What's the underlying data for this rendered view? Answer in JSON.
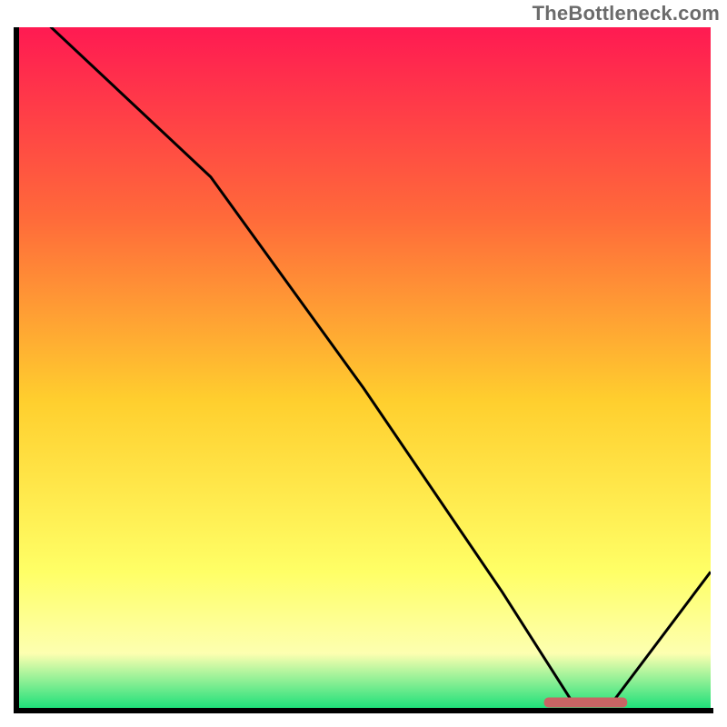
{
  "watermark": "TheBottleneck.com",
  "colors": {
    "gradient_top": "#ff1a52",
    "gradient_mid_upper": "#ff6a3a",
    "gradient_mid": "#ffcf2e",
    "gradient_mid_lower": "#ffff66",
    "gradient_lower": "#fdffb0",
    "gradient_bottom": "#1fe07a",
    "marker": "#c86464",
    "line": "#000000"
  },
  "chart_data": {
    "type": "line",
    "title": "",
    "xlabel": "",
    "ylabel": "",
    "xlim": [
      0,
      100
    ],
    "ylim": [
      0,
      100
    ],
    "grid": false,
    "legend": false,
    "x": [
      0,
      5,
      28,
      50,
      70,
      80,
      86,
      100
    ],
    "values": [
      110,
      100,
      78,
      47,
      17,
      1,
      1,
      20
    ],
    "marker_region": {
      "x_start": 76,
      "x_end": 88,
      "y": 0.8
    },
    "annotations": []
  }
}
